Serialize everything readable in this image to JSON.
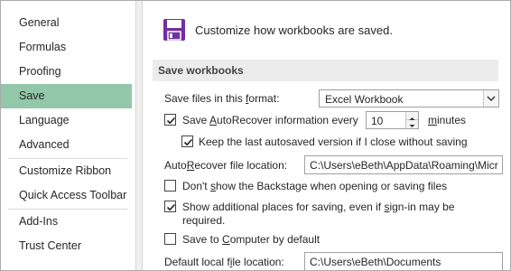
{
  "sidebar": {
    "items": [
      {
        "label": "General"
      },
      {
        "label": "Formulas"
      },
      {
        "label": "Proofing"
      },
      {
        "label": "Save"
      },
      {
        "label": "Language"
      },
      {
        "label": "Advanced"
      },
      {
        "label": "Customize Ribbon"
      },
      {
        "label": "Quick Access Toolbar"
      },
      {
        "label": "Add-Ins"
      },
      {
        "label": "Trust Center"
      }
    ],
    "selected_item": "Save",
    "selected_color": "#92c7a9"
  },
  "header": {
    "icon": "floppy-disk-icon",
    "icon_color": "#7030a0",
    "text": "Customize how workbooks are saved."
  },
  "section": {
    "title": "Save workbooks"
  },
  "save_format": {
    "label_pre": "Save files in this ",
    "label_u": "f",
    "label_post": "ormat:",
    "value": "Excel Workbook"
  },
  "autorecover": {
    "checked": true,
    "label_pre": "Save ",
    "label_u": "A",
    "label_post": "utoRecover information every",
    "value": "10",
    "unit_u": "m",
    "unit_post": "inutes"
  },
  "keep_last": {
    "checked": true,
    "label": "Keep the last autosaved version if I close without saving"
  },
  "autorecover_location": {
    "label_pre": "Auto",
    "label_u": "R",
    "label_post": "ecover file location:",
    "value": "C:\\Users\\eBeth\\AppData\\Roaming\\Micr"
  },
  "backstage": {
    "checked": false,
    "label_pre": "Don't ",
    "label_u": "s",
    "label_post": "how the Backstage when opening or saving files"
  },
  "additional_places": {
    "checked": true,
    "label_line1_pre": "Show additional places for saving, even if ",
    "label_line1_u": "s",
    "label_line1_post": "ign-in may be",
    "label_line2": "required."
  },
  "save_to_computer": {
    "checked": false,
    "label_pre": "Save to ",
    "label_u": "C",
    "label_post": "omputer by default"
  },
  "default_location": {
    "label_pre": "Default local f",
    "label_u": "i",
    "label_post": "le location:",
    "value": "C:\\Users\\eBeth\\Documents"
  }
}
